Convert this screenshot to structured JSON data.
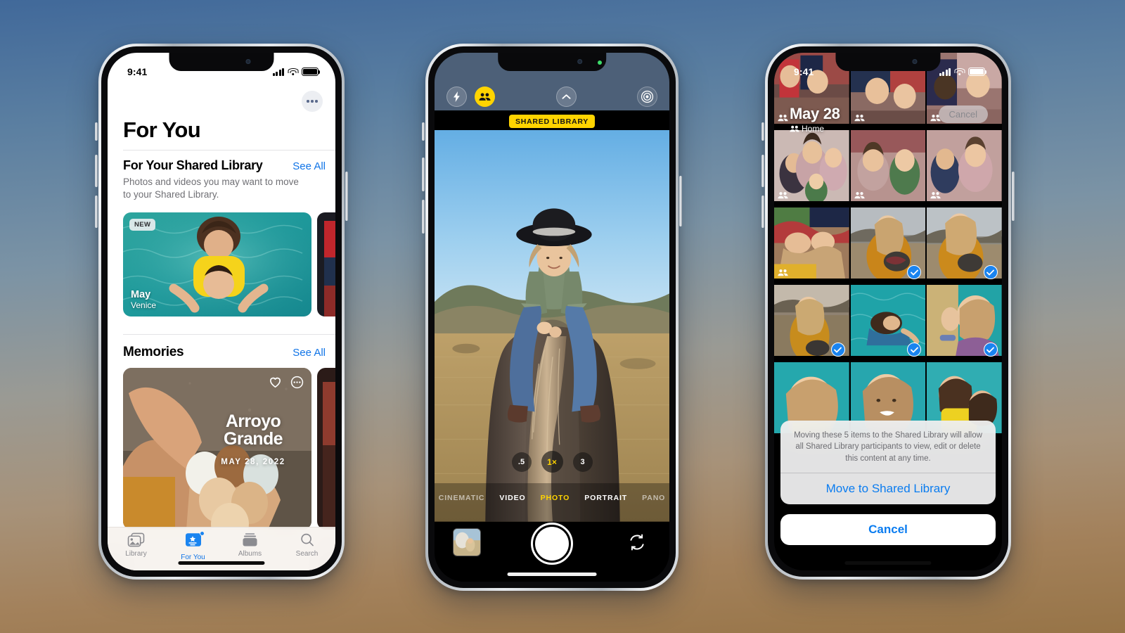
{
  "background": {
    "top_color": "#41699a",
    "bottom_color": "#977447"
  },
  "phones": {
    "left": {
      "name": "Photos app - For You",
      "status_bar": {
        "time": "9:41",
        "cellular": "signal-bars",
        "wifi": "wifi-icon",
        "battery": "battery-icon"
      },
      "more_button": "more-options",
      "page_title": "For You",
      "shared_library_section": {
        "title": "For Your Shared Library",
        "see_all": "See All",
        "subtitle": "Photos and videos you may want to move to your Shared Library.",
        "card": {
          "badge": "NEW",
          "month": "May",
          "place": "Venice"
        }
      },
      "memories_section": {
        "title": "Memories",
        "see_all": "See All",
        "card": {
          "title": "Arroyo Grande",
          "date": "MAY 28, 2022",
          "favorite_icon": "heart-icon",
          "more_icon": "ellipsis-icon"
        }
      },
      "tab_bar": [
        {
          "label": "Library",
          "icon": "photos-library-icon",
          "active": false,
          "badge": false
        },
        {
          "label": "For You",
          "icon": "for-you-icon",
          "active": true,
          "badge": true
        },
        {
          "label": "Albums",
          "icon": "albums-icon",
          "active": false,
          "badge": false
        },
        {
          "label": "Search",
          "icon": "search-icon",
          "active": false,
          "badge": false
        }
      ]
    },
    "center": {
      "name": "Camera app - Photo mode",
      "controls": {
        "flash": "flash-icon",
        "shared_library_toggle": "shared-library-people-icon",
        "chevron": "chevron-up-icon",
        "live_photo": "live-photo-icon"
      },
      "shared_badge": "SHARED LIBRARY",
      "zoom_levels": [
        {
          "label": ".5",
          "active": false
        },
        {
          "label": "1×",
          "active": true
        },
        {
          "label": "3",
          "active": false
        }
      ],
      "modes": [
        {
          "label": "CINEMATIC",
          "active": false
        },
        {
          "label": "VIDEO",
          "active": false
        },
        {
          "label": "PHOTO",
          "active": true
        },
        {
          "label": "PORTRAIT",
          "active": false
        },
        {
          "label": "PANO",
          "active": false
        }
      ],
      "shutter": "shutter-button",
      "thumbnail": "last-photo-thumbnail",
      "flip_camera": "flip-camera-icon"
    },
    "right": {
      "name": "Photos grid with selection + action sheet",
      "status_bar": {
        "time": "9:41"
      },
      "date_header": "May 28",
      "location": "Home",
      "cancel_top": "Cancel",
      "selected_count": 5,
      "grid": [
        [
          {
            "shared": true,
            "selected": false,
            "tone": "#7e5d5c"
          },
          {
            "shared": true,
            "selected": false,
            "tone": "#8a6a63"
          },
          {
            "shared": true,
            "selected": false,
            "tone": "#9a7570"
          }
        ],
        [
          {
            "shared": true,
            "selected": false,
            "tone": "#b39a95"
          },
          {
            "shared": true,
            "selected": false,
            "tone": "#a78d8c"
          },
          {
            "shared": true,
            "selected": false,
            "tone": "#b9a09b"
          }
        ],
        [
          {
            "shared": true,
            "selected": false,
            "tone": "#9a7a57"
          },
          {
            "shared": false,
            "selected": true,
            "tone": "#a4762f"
          },
          {
            "shared": false,
            "selected": true,
            "tone": "#b07f33"
          }
        ],
        [
          {
            "shared": false,
            "selected": true,
            "tone": "#a47b3e"
          },
          {
            "shared": false,
            "selected": true,
            "tone": "#1fa0a6"
          },
          {
            "shared": false,
            "selected": true,
            "tone": "#27a8ab"
          }
        ],
        [
          {
            "shared": false,
            "selected": false,
            "tone": "#2aa9ad"
          },
          {
            "shared": false,
            "selected": false,
            "tone": "#2ba6ae"
          },
          {
            "shared": false,
            "selected": false,
            "tone": "#31adb2"
          }
        ]
      ],
      "action_sheet": {
        "message": "Moving these 5 items to the Shared Library will allow all Shared Library participants to view, edit or delete this content at any time.",
        "confirm": "Move to Shared Library",
        "cancel": "Cancel"
      }
    }
  }
}
